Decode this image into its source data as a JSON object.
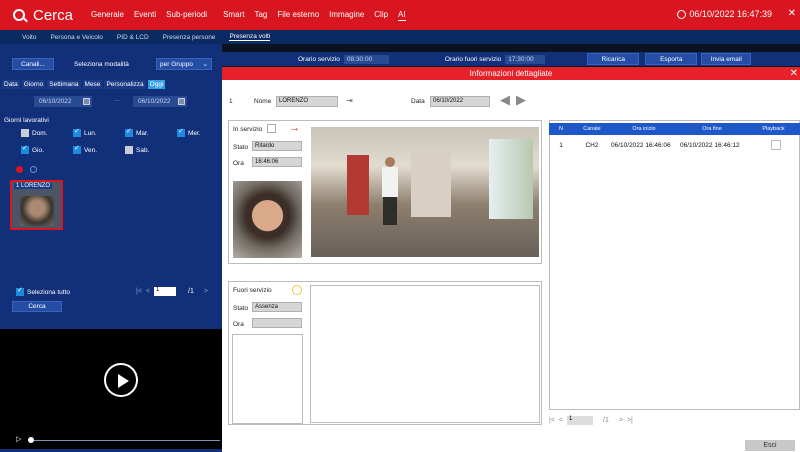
{
  "app": {
    "title": "Cerca",
    "logo_icon": "search-icon"
  },
  "menu": [
    {
      "label": "Generale"
    },
    {
      "label": "Eventi"
    },
    {
      "label": "Sub-periodi"
    },
    {
      "label": "Smart"
    },
    {
      "label": "Tag"
    },
    {
      "label": "File esterno"
    },
    {
      "label": "Immagine"
    },
    {
      "label": "Clip"
    },
    {
      "label": "AI"
    }
  ],
  "clock": "06/10/2022 16:47:39",
  "subtabs": [
    {
      "label": "Volto"
    },
    {
      "label": "Persona e Veicolo"
    },
    {
      "label": "PID & LCD"
    },
    {
      "label": "Presenza persone"
    },
    {
      "label": "Presenza volti"
    }
  ],
  "left": {
    "channels_btn": "Canali...",
    "mode_label": "Seleziona modalità",
    "mode_value": "per Gruppo",
    "periods": [
      "Data",
      "Giorno",
      "Settimana",
      "Mese",
      "Personalizza",
      "Oggi"
    ],
    "date_from": "06/10/2022",
    "date_to": "06/10/2022",
    "workdays_title": "Giorni lavorativi",
    "days": [
      {
        "label": "Dom.",
        "checked": false
      },
      {
        "label": "Lun.",
        "checked": true
      },
      {
        "label": "Mar.",
        "checked": true
      },
      {
        "label": "Mer.",
        "checked": true
      },
      {
        "label": "Gio.",
        "checked": true
      },
      {
        "label": "Ven.",
        "checked": true
      },
      {
        "label": "Sab.",
        "checked": false
      }
    ],
    "thumb_label": "1 LORENZO",
    "select_all": "Seleziona tutto",
    "pager_current": "1",
    "pager_total": "/1",
    "search_btn": "Cerca"
  },
  "filter_bar": {
    "in_label": "Orario servizio",
    "in_time": "08:30:00",
    "out_label": "Orario fuori servizio",
    "out_time": "17:30:00",
    "reload": "Ricarica",
    "export": "Esporta",
    "email": "Invia email"
  },
  "panel": {
    "title": "Informazioni dettagliate",
    "index": "1",
    "name_label": "Nome",
    "name_value": "LORENZO",
    "date_label": "Data",
    "date_value": "06/10/2022",
    "in_service_label": "In servizio",
    "state_label": "Stato",
    "state_in_value": "Ritardo",
    "time_label": "Ora",
    "time_in_value": "16:46:06",
    "out_service_label": "Fuori servizio",
    "state_out_value": "Assenza",
    "time_out_value": "",
    "table_headers": [
      "N",
      "Canale",
      "Ora inizio",
      "Ora fine",
      "Playback"
    ],
    "table_rows": [
      {
        "n": "1",
        "canale": "CH2",
        "inizio": "06/10/2022 16:46:06",
        "fine": "06/10/2022 16:46:12"
      }
    ],
    "table_page": "1",
    "table_total": "/1",
    "exit": "Esci"
  }
}
